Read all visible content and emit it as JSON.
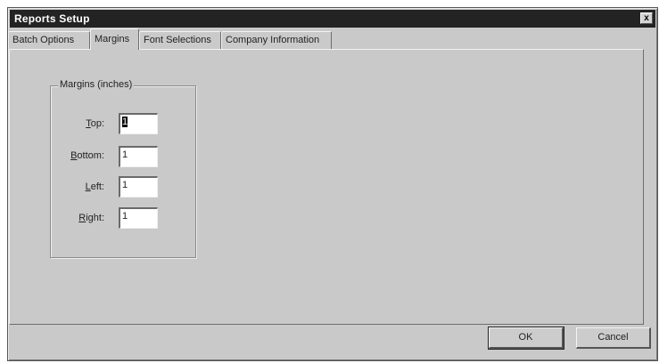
{
  "window": {
    "title": "Reports Setup",
    "close_glyph": "x"
  },
  "tabs": [
    {
      "label": "Batch Options",
      "active": false
    },
    {
      "label": "Margins",
      "active": true
    },
    {
      "label": "Font Selections",
      "active": false
    },
    {
      "label": "Company Information",
      "active": false
    }
  ],
  "margins": {
    "group_label": "Margins (inches)",
    "fields": [
      {
        "label_first": "T",
        "label_rest": "op:",
        "value": "1"
      },
      {
        "label_first": "B",
        "label_rest": "ottom:",
        "value": "1"
      },
      {
        "label_first": "L",
        "label_rest": "eft:",
        "value": "1"
      },
      {
        "label_first": "R",
        "label_rest": "ight:",
        "value": "1"
      }
    ]
  },
  "buttons": {
    "ok": "OK",
    "cancel": "Cancel"
  }
}
